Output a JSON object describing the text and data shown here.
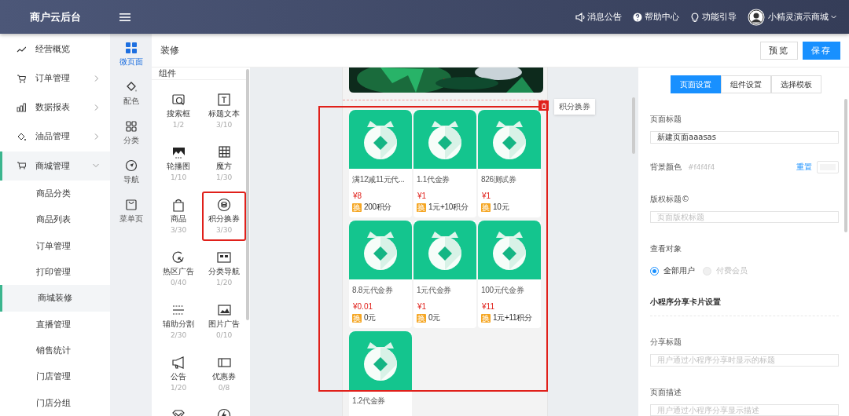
{
  "header": {
    "logo": "商户云后台",
    "links": [
      {
        "label": "消息公告"
      },
      {
        "label": "帮助中心"
      },
      {
        "label": "功能引导"
      }
    ],
    "user": "小精灵演示商城"
  },
  "sidebar": {
    "items": [
      {
        "label": "经营概览",
        "selected": false
      },
      {
        "label": "订单管理",
        "selected": false,
        "expanded": false
      },
      {
        "label": "数据报表",
        "selected": false,
        "expanded": false
      },
      {
        "label": "油品管理",
        "selected": false,
        "expanded": false
      },
      {
        "label": "商城管理",
        "selected": true,
        "expanded": true,
        "children": [
          {
            "label": "商品分类",
            "selected": false
          },
          {
            "label": "商品列表",
            "selected": false
          },
          {
            "label": "订单管理",
            "selected": false
          },
          {
            "label": "打印管理",
            "selected": false
          },
          {
            "label": "商城装修",
            "selected": true
          },
          {
            "label": "直播管理",
            "selected": false
          },
          {
            "label": "销售统计",
            "selected": false
          },
          {
            "label": "门店管理",
            "selected": false
          },
          {
            "label": "门店分组",
            "selected": false
          }
        ]
      }
    ]
  },
  "rail": [
    {
      "label": "微页面",
      "selected": true
    },
    {
      "label": "配色",
      "selected": false
    },
    {
      "label": "分类",
      "selected": false
    },
    {
      "label": "导航",
      "selected": false
    },
    {
      "label": "菜单页",
      "selected": false
    }
  ],
  "toolbar": {
    "title": "装修",
    "buttons": [
      {
        "label": "预览",
        "kind": "default"
      },
      {
        "label": "保存",
        "kind": "primary"
      }
    ]
  },
  "components": {
    "title": "组件",
    "items": [
      {
        "label": "搜索框",
        "count": "1/2",
        "selected": false
      },
      {
        "label": "标题文本",
        "count": "3/10",
        "selected": false
      },
      {
        "label": "轮播图",
        "count": "1/10",
        "selected": false
      },
      {
        "label": "魔方",
        "count": "1/30",
        "selected": false
      },
      {
        "label": "商品",
        "count": "3/30",
        "selected": false
      },
      {
        "label": "积分换券",
        "count": "3/30",
        "selected": true
      },
      {
        "label": "热区广告",
        "count": "0/40",
        "selected": false
      },
      {
        "label": "分类导航",
        "count": "1/20",
        "selected": false
      },
      {
        "label": "辅助分割",
        "count": "2/30",
        "selected": false
      },
      {
        "label": "图片广告",
        "count": "0/10",
        "selected": false
      },
      {
        "label": "公告",
        "count": "1/20",
        "selected": false
      },
      {
        "label": "优惠券",
        "count": "0/8",
        "selected": false
      },
      {
        "selected": false
      },
      {
        "selected": false
      }
    ]
  },
  "canvas": {
    "tooltip": "积分换券",
    "coupons": [
      {
        "title": "满12减11元代...",
        "price": "¥8",
        "badge": "换",
        "exchange": "200积分"
      },
      {
        "title": "1.1代金券",
        "price": "¥1",
        "badge": "换",
        "exchange": "1元+10积分"
      },
      {
        "title": "826测试券",
        "price": "¥1",
        "badge": "换",
        "exchange": "10元"
      },
      {
        "title": "8.8元代金券",
        "price": "¥0.01",
        "badge": "换",
        "exchange": "0元"
      },
      {
        "title": "1元代金券",
        "price": "¥1",
        "badge": "换",
        "exchange": "0元"
      },
      {
        "title": "100元代金券",
        "price": "¥11",
        "badge": "换",
        "exchange": "1元+11积分"
      },
      {
        "title": "1.2代金券"
      }
    ]
  },
  "settings": {
    "tabs": [
      {
        "label": "页面设置",
        "selected": true
      },
      {
        "label": "组件设置",
        "selected": false
      },
      {
        "label": "选择模板",
        "selected": false
      }
    ],
    "fields": [
      {
        "kind": "input",
        "label": "页面标题",
        "value": "新建页面aaasas"
      },
      {
        "kind": "color",
        "label": "背景颜色",
        "hint": "#f4f4f4",
        "reset": "重置",
        "color": "#f4f4f4"
      },
      {
        "kind": "input",
        "label": "版权标题©",
        "placeholder": "页面版权标题"
      },
      {
        "kind": "radio",
        "label": "查看对象",
        "options": [
          {
            "label": "全部用户",
            "selected": true,
            "disabled": false
          },
          {
            "label": "付费会员",
            "selected": false,
            "disabled": true
          }
        ]
      },
      {
        "kind": "section",
        "label": "小程序分享卡片设置"
      },
      {
        "kind": "input",
        "label": "分享标题",
        "placeholder": "用户通过小程序分享时显示的标题"
      },
      {
        "kind": "input",
        "label": "页面描述",
        "placeholder": "用户通过小程序分享显示描述"
      }
    ]
  }
}
